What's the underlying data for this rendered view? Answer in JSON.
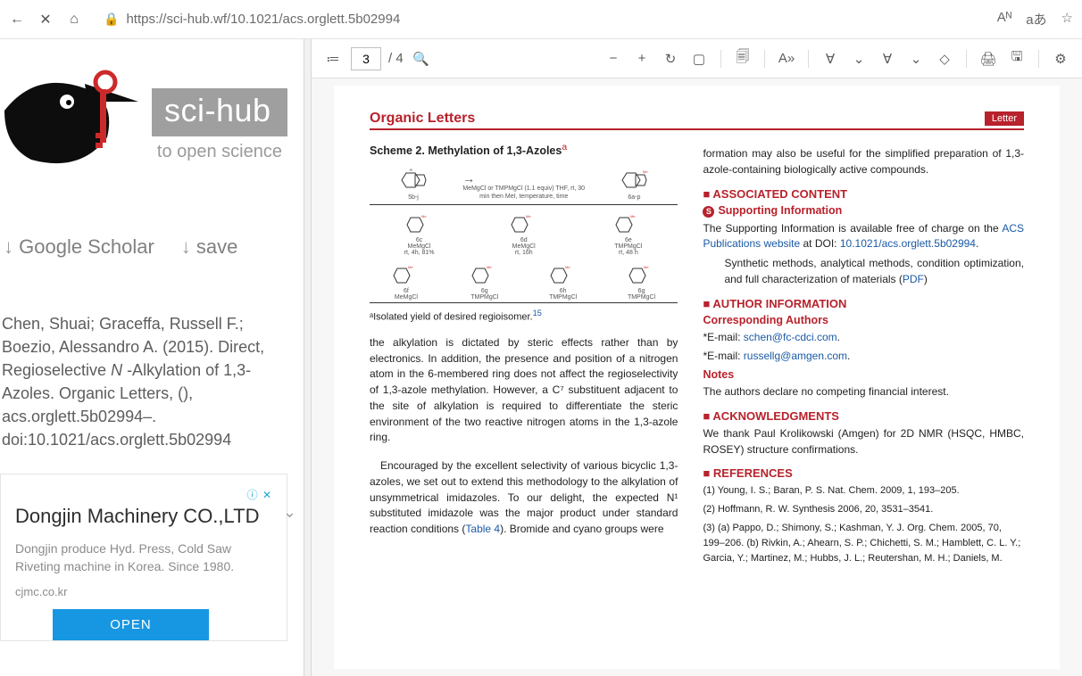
{
  "browser": {
    "url": "https://sci-hub.wf/10.1021/acs.orglett.5b02994",
    "right_icons": [
      "Aᴺ",
      "aあ",
      "☆"
    ]
  },
  "sidebar": {
    "brand": "sci-hub",
    "tagline": "to open science",
    "links": {
      "scholar": "Google Scholar",
      "save": "save"
    },
    "citation": "Chen, Shuai; Graceffa, Russell F.; Boezio, Alessandro A. (2015). Direct, Regioselective <i>N</i> -Alkylation of 1,3-Azoles. Organic Letters, (), acs.orglett.5b02994–. doi:10.1021/acs.orglett.5b02994",
    "ad": {
      "close": "ⓘ ✕",
      "title": "Dongjin Machinery CO.,LTD",
      "desc": "Dongjin produce Hyd. Press, Cold Saw Riveting machine in Korea. Since 1980.",
      "url": "cjmc.co.kr",
      "cta": "OPEN"
    }
  },
  "toolbar": {
    "page_current": "3",
    "page_total": "/ 4"
  },
  "paper": {
    "journal": "Organic Letters",
    "badge": "Letter",
    "scheme_title": "Scheme 2. Methylation of 1,3-Azoles",
    "scheme_cond": "MeMgCl or TMPMgCl\n(1.1 equiv) THF, rt, 30 min\nthen MeI, temperature, time",
    "scheme_foot": "ᵃIsolated yield of desired regioisomer.",
    "left_body1": "the alkylation is dictated by steric effects rather than by electronics. In addition, the presence and position of a nitrogen atom in the 6-membered ring does not affect the regioselectivity of 1,3-azole methylation. However, a C⁷ substituent adjacent to the site of alkylation is required to differentiate the steric environment of the two reactive nitrogen atoms in the 1,3-azole ring.",
    "left_body2": "Encouraged by the excellent selectivity of various bicyclic 1,3-azoles, we set out to extend this methodology to the alkylation of unsymmetrical imidazoles. To our delight, the expected N¹ substituted imidazole was the major product under standard reaction conditions (Table 4). Bromide and cyano groups were",
    "right_body1": "formation may also be useful for the simplified preparation of 1,3-azole-containing biologically active compounds.",
    "assoc_h": "ASSOCIATED CONTENT",
    "si_h": "Supporting Information",
    "si_txt1": "The Supporting Information is available free of charge on the ",
    "si_link": "ACS Publications website",
    "si_txt2": " at DOI: ",
    "si_doi": "10.1021/acs.orglett.5b02994",
    "si_txt3": "Synthetic methods, analytical methods, condition optimization, and full characterization of materials (PDF)",
    "auth_h": "AUTHOR INFORMATION",
    "corr_h": "Corresponding Authors",
    "email1": "*E-mail: ",
    "email1v": "schen@fc-cdci.com",
    "email2": "*E-mail: ",
    "email2v": "russellg@amgen.com",
    "notes_h": "Notes",
    "notes_t": "The authors declare no competing financial interest.",
    "ack_h": "ACKNOWLEDGMENTS",
    "ack_t": "We thank Paul Krolikowski (Amgen) for 2D NMR (HSQC, HMBC, ROSEY) structure confirmations.",
    "ref_h": "REFERENCES",
    "refs": [
      "(1) Young, I. S.; Baran, P. S. Nat. Chem. 2009, 1, 193–205.",
      "(2) Hoffmann, R. W. Synthesis 2006, 20, 3531–3541.",
      "(3) (a) Pappo, D.; Shimony, S.; Kashman, Y. J. Org. Chem. 2005, 70, 199–206. (b) Rivkin, A.; Ahearn, S. P.; Chichetti, S. M.; Hamblett, C. L. Y.; Garcia, Y.; Martinez, M.; Hubbs, J. L.; Reutershan, M. H.; Daniels, M."
    ]
  }
}
